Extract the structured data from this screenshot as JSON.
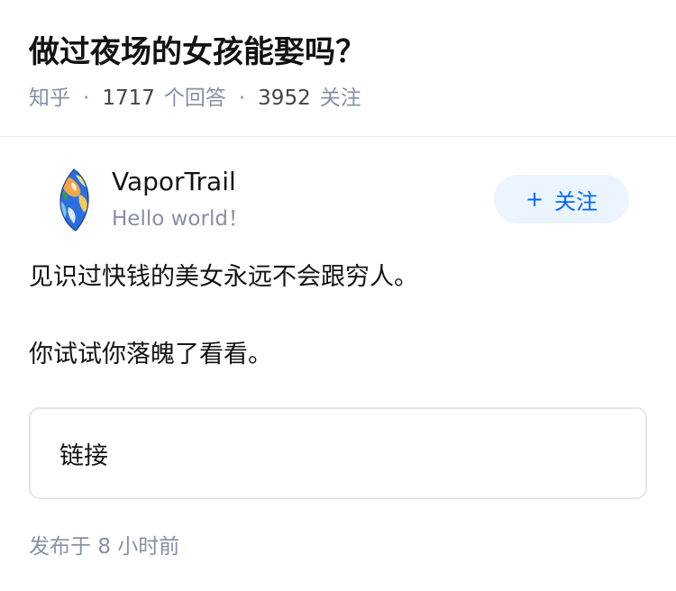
{
  "question": {
    "title": "做过夜场的女孩能娶吗？",
    "meta": {
      "source": "知乎",
      "answers_count": "1717",
      "answers_label": "个回答",
      "followers_count": "3952",
      "followers_label": "关注",
      "separator": "·"
    }
  },
  "author": {
    "name": "VaporTrail",
    "bio": "Hello world！",
    "avatar_icon": "globe-leaf-avatar",
    "follow_button": {
      "plus": "+",
      "label": "关注"
    }
  },
  "answer": {
    "paragraphs": [
      "见识过快钱的美女永远不会跟穷人。",
      "你试试你落魄了看看。"
    ],
    "link_card_label": "链接"
  },
  "footer": {
    "publish_label": "发布于",
    "publish_value": "8 小时前"
  },
  "colors": {
    "primary_text": "#121212",
    "secondary_text": "#8590a6",
    "follow_bg": "#ebf5ff",
    "follow_text": "#0066ff",
    "border": "#e6e6e6"
  }
}
